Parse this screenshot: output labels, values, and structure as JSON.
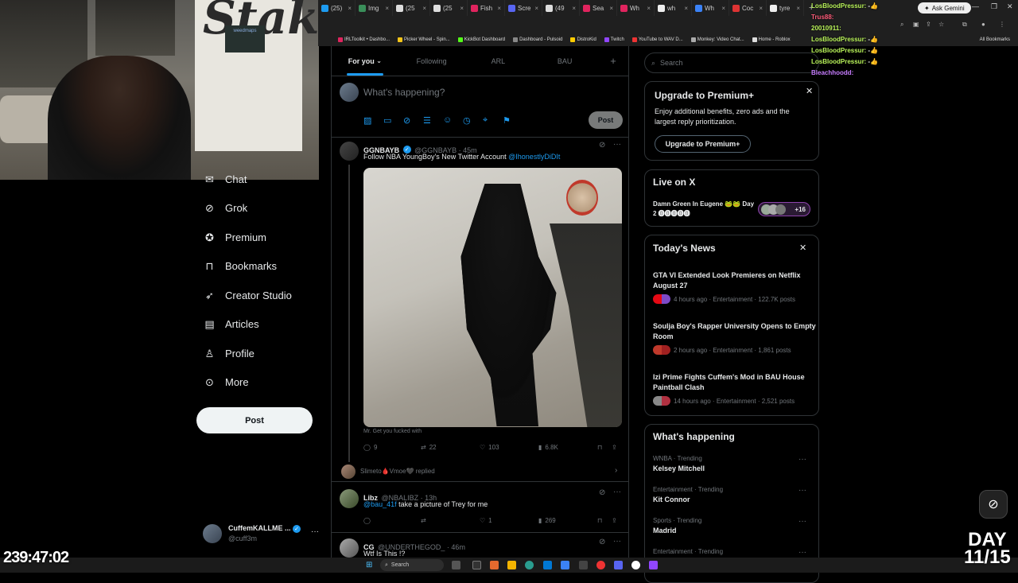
{
  "browser": {
    "tabs": [
      {
        "label": "(25)",
        "color": "#1d9bf0"
      },
      {
        "label": "Img",
        "color": "#3a8f5a"
      },
      {
        "label": "(25",
        "color": "#ddd"
      },
      {
        "label": "(25",
        "color": "#ddd"
      },
      {
        "label": "Fish",
        "color": "#e0245e"
      },
      {
        "label": "Scre",
        "color": "#5865f2"
      },
      {
        "label": "(49",
        "color": "#ddd"
      },
      {
        "label": "Sea",
        "color": "#e0245e"
      },
      {
        "label": "Wh",
        "color": "#e0245e"
      },
      {
        "label": "wh",
        "color": "#eee"
      },
      {
        "label": "Wh",
        "color": "#3b82f6"
      },
      {
        "label": "Coc",
        "color": "#d33"
      },
      {
        "label": "tyre",
        "color": "#eee"
      }
    ],
    "new_tab": "+",
    "gemini_label": "Ask Gemini",
    "bookmarks": [
      {
        "label": "IRLToolkit • Dashbo...",
        "color": "#e0245e"
      },
      {
        "label": "Picker Wheel - Spin...",
        "color": "#f5c518"
      },
      {
        "label": "KickBot Dashboard",
        "color": "#53fc18"
      },
      {
        "label": "Dashboard - Pulsoid",
        "color": "#888"
      },
      {
        "label": "DistroKid",
        "color": "#ffcc00"
      },
      {
        "label": "Twitch",
        "color": "#9146ff"
      },
      {
        "label": "YouTube to WAV D...",
        "color": "#e33"
      },
      {
        "label": "Monkey: Video Chat...",
        "color": "#aaa"
      },
      {
        "label": "Home - Roblox",
        "color": "#ddd"
      }
    ],
    "all_bookmarks": "All Bookmarks"
  },
  "webcam": {
    "logo_text": "Stake",
    "banner_text": "weedmaps"
  },
  "nav": {
    "items": [
      {
        "label": "Chat",
        "icon": "chat-icon"
      },
      {
        "label": "Grok",
        "icon": "grok-icon"
      },
      {
        "label": "Premium",
        "icon": "premium-icon"
      },
      {
        "label": "Bookmarks",
        "icon": "bookmark-icon"
      },
      {
        "label": "Creator Studio",
        "icon": "rocket-icon"
      },
      {
        "label": "Articles",
        "icon": "articles-icon"
      },
      {
        "label": "Profile",
        "icon": "profile-icon"
      },
      {
        "label": "More",
        "icon": "more-icon"
      }
    ],
    "post_label": "Post",
    "account": {
      "name": "CuffemKALLME ...",
      "handle": "@cuff3m"
    }
  },
  "feed": {
    "tabs": [
      {
        "label": "For you"
      },
      {
        "label": "Following"
      },
      {
        "label": "ARL"
      },
      {
        "label": "BAU"
      }
    ],
    "add_tab": "+",
    "compose_placeholder": "What's happening?",
    "compose_post": "Post",
    "tweets": [
      {
        "name": "GGNBAYB",
        "handle": "@GGNBAYB · 45m",
        "text": "Follow NBA YoungBoy's New Twitter Account ",
        "mention": "@IhonestlyDiDIt",
        "caption": "Mr. Get you fucked with",
        "replies": "9",
        "reposts": "22",
        "likes": "103",
        "views": "6.8K"
      },
      {
        "replied_by": "Slimeto🩸Vmoe🖤 replied"
      },
      {
        "name": "Libz",
        "handle": "@NBALIBZ · 13h",
        "mention": "@bau_41f",
        "text": " take a picture of Trey for me",
        "likes": "1",
        "views": "269"
      },
      {
        "name": "CG",
        "handle": "@UNDERTHEGOD_ · 46m",
        "text": "Wtf Is This  !?"
      }
    ]
  },
  "sidebar_right": {
    "search_placeholder": "Search",
    "premium": {
      "title": "Upgrade to Premium+",
      "body": "Enjoy additional benefits, zero ads and the largest reply prioritization.",
      "button": "Upgrade to Premium+"
    },
    "live": {
      "title": "Live on X",
      "stream": "Damn Green In Eugene 🐸🐸 Day 2 ⓿⓿⓿⓿⓿",
      "count": "+16"
    },
    "news": {
      "title": "Today's News",
      "items": [
        {
          "title": "GTA VI Extended Look Premieres on Netflix August 27",
          "meta": "4 hours ago · Entertainment · 122.7K posts"
        },
        {
          "title": "Soulja Boy's Rapper University Opens to Empty Room",
          "meta": "2 hours ago · Entertainment · 1,861 posts"
        },
        {
          "title": "Izi Prime Fights Cuffem's Mod in BAU House Paintball Clash",
          "meta": "14 hours ago · Entertainment · 2,521 posts"
        }
      ]
    },
    "happening": {
      "title": "What's happening",
      "items": [
        {
          "category": "WNBA · Trending",
          "topic": "Kelsey Mitchell"
        },
        {
          "category": "Entertainment · Trending",
          "topic": "Kit Connor"
        },
        {
          "category": "Sports · Trending",
          "topic": "Madrid"
        },
        {
          "category": "Entertainment · Trending",
          "topic": ""
        }
      ]
    }
  },
  "chat": {
    "lines": [
      {
        "user": "LosBloodPressur:",
        "msg": "-👍",
        "color": "#b9f35a"
      },
      {
        "user": "Trus88:",
        "msg": "",
        "color": "#ff5d7a"
      },
      {
        "user": "20010911:",
        "msg": "",
        "color": "#b9f35a"
      },
      {
        "user": "LosBloodPressur:",
        "msg": "-👍",
        "color": "#b9f35a"
      },
      {
        "user": "LosBloodPressur:",
        "msg": "-👍",
        "color": "#b9f35a"
      },
      {
        "user": "LosBloodPressur:",
        "msg": "-👍",
        "color": "#b9f35a"
      },
      {
        "user": "Bleachhoodd:",
        "msg": "",
        "color": "#c77dff"
      }
    ]
  },
  "overlay": {
    "timer": "239:47:02",
    "day_label": "DAY",
    "day_value": "11/15"
  },
  "taskbar": {
    "search_label": "Search"
  }
}
